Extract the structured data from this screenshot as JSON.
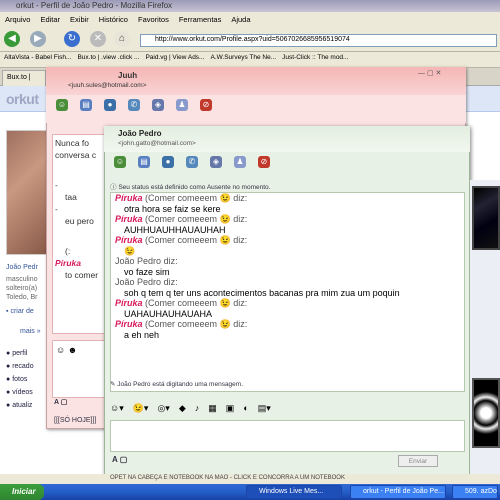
{
  "browser": {
    "title": "orkut - Perfil de João Pedro - Mozilla Firefox",
    "menu": [
      "Arquivo",
      "Editar",
      "Exibir",
      "Histórico",
      "Favoritos",
      "Ferramentas",
      "Ajuda"
    ],
    "url": "http://www.orkut.com/Profile.aspx?uid=5067026685956519074",
    "bookmarks": [
      "AltaVista - Babel Fish...",
      "Bux.to | .view .click ...",
      "Paid.vg | View Ads...",
      "A.W.Surveys The Ne...",
      "Just-Click :: The mod..."
    ],
    "tabs": [
      "Bux.to |"
    ],
    "status": "OPET NA CABEÇA E NOTEBOOK NA MÃO - CLICK E CONCORRA A UM NOTEBOOK"
  },
  "orkut": {
    "logo": "orkut",
    "profile_name": "João Pedr",
    "profile_info": [
      "masculino",
      "solteiro(a)",
      "Toledo, Br"
    ],
    "links": [
      "criar de",
      "mais »"
    ],
    "menu": [
      "perfil",
      "recado",
      "fotos",
      "vídeos",
      "atualiz"
    ],
    "footer": "[[[SÓ HOJE]]]"
  },
  "chat1": {
    "title": "Juuh",
    "email": "<juuh.sules@hotmail.com>",
    "lines": [
      "Nunca fo",
      "conversa c",
      "-",
      "taa",
      "-",
      "eu pero",
      "(:",
      "Píruka",
      "to comer"
    ]
  },
  "chat2": {
    "title": "João Pedro",
    "email": "<john.gatto@hotmail.com>",
    "status": "Seu status está definido como Ausente no momento.",
    "messages": [
      {
        "sender": "Píruka",
        "suffix": "(Comer comeeem",
        "says": "diz:",
        "text": "otra hora se faiz se kere"
      },
      {
        "sender": "Píruka",
        "suffix": "(Comer comeeem",
        "says": "diz:",
        "text": "AUHHUAUHHAUAUHAH"
      },
      {
        "sender": "Píruka",
        "suffix": "(Comer comeeem",
        "says": "diz:",
        "text": "😉"
      },
      {
        "sender": "João Pedro",
        "suffix": "",
        "says": "diz:",
        "text": "vo faze sim"
      },
      {
        "sender": "João Pedro",
        "suffix": "",
        "says": "diz:",
        "text": "soh q tem q ter uns acontecimentos bacanas pra mim zua um poquin"
      },
      {
        "sender": "Píruka",
        "suffix": "(Comer comeeem",
        "says": "diz:",
        "text": "UAHAUHAUHAUAHA"
      },
      {
        "sender": "Píruka",
        "suffix": "(Comer comeeem",
        "says": "diz:",
        "text": "a eh neh"
      }
    ],
    "typing": "João Pedro está digitando uma mensagem.",
    "send": "Enviar"
  },
  "taskbar": {
    "start": "Iniciar",
    "tasks": [
      "Windows Live Mes...",
      "orkut - Perfil de João Pe...",
      "509. azDo"
    ]
  },
  "colors": {
    "orkut_blue": "#dde6f7",
    "chat_pink": "#fbe3e3",
    "chat_green": "#e7f1e5",
    "name_pink": "#d8185c"
  }
}
